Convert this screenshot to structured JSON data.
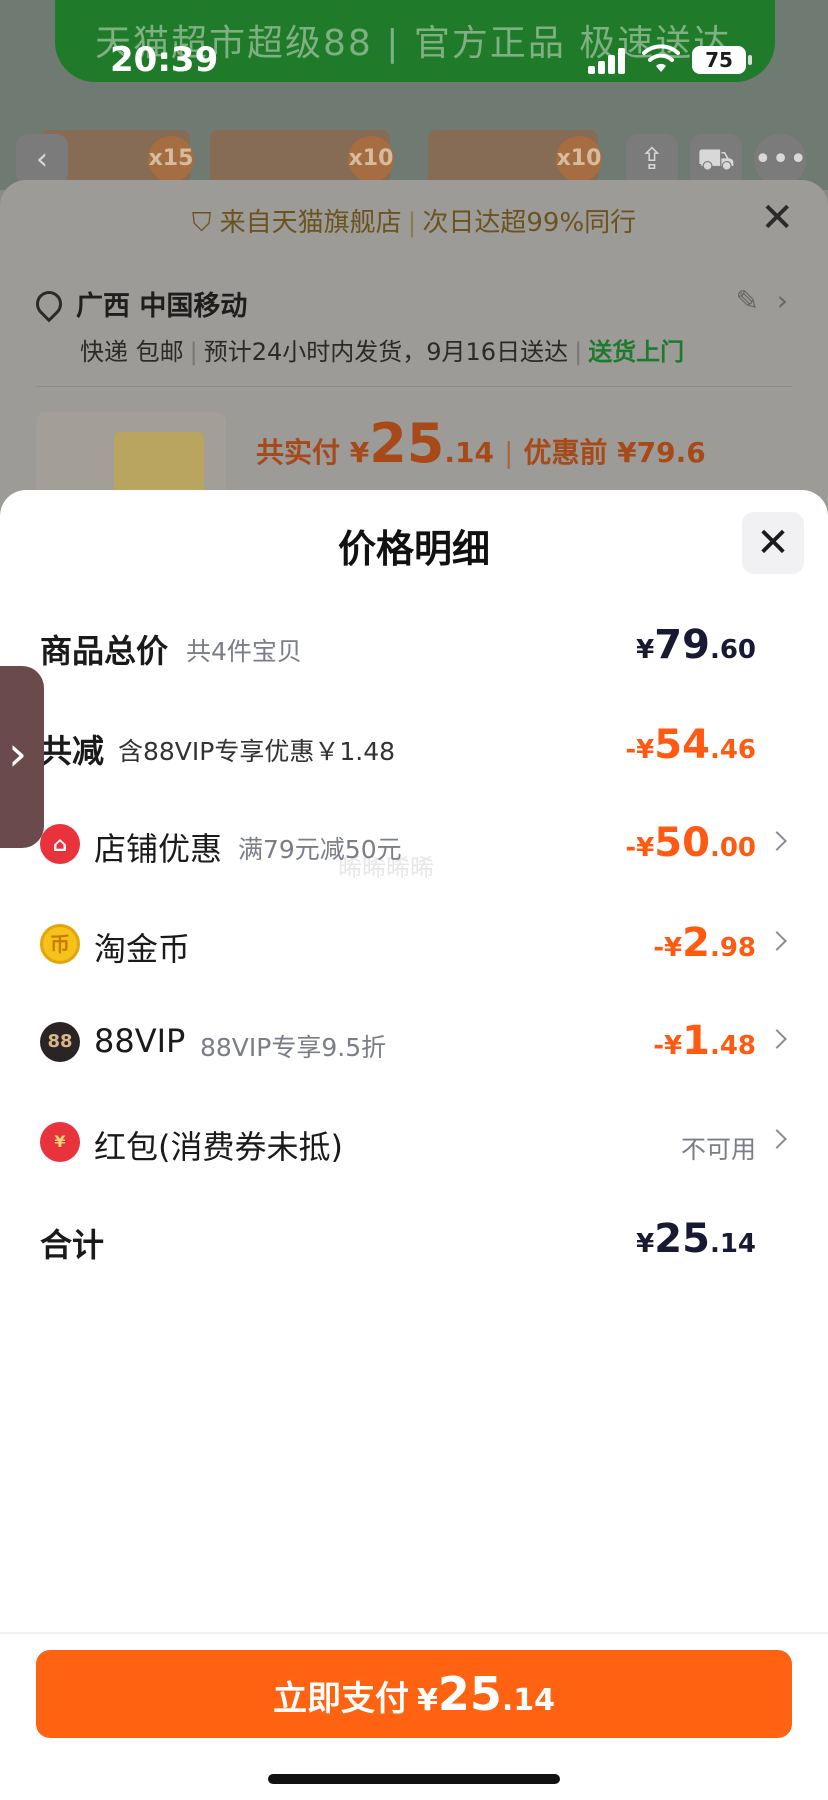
{
  "status_bar": {
    "time": "20:39",
    "battery": "75"
  },
  "background": {
    "banner_text": "天猫超市超级88 | 官方正品  极速送达",
    "thumb_badges": [
      "x15",
      "x10",
      "x10"
    ],
    "shop_tip": {
      "part1": "来自天猫旗舰店",
      "part2": "次日达超99%同行"
    },
    "address": "广西 中国移动",
    "delivery": {
      "method": "快递 包邮",
      "eta": "预计24小时内发货，9月16日送达",
      "door": "送货上门"
    },
    "pay_summary": {
      "label": "共实付 ¥",
      "int": "25",
      "dec": ".14",
      "before_label": "优惠前 ¥79.6"
    }
  },
  "sheet": {
    "title": "价格明细",
    "watermark": "晞晞晞晞",
    "rows": {
      "total": {
        "label": "商品总价",
        "sub": "共4件宝贝",
        "cur": "¥",
        "int": "79",
        "dec": ".60"
      },
      "reduce": {
        "label": "共减",
        "sub": "含88VIP专享优惠￥1.48",
        "cur": "-¥",
        "int": "54",
        "dec": ".46"
      },
      "shop": {
        "label": "店铺优惠",
        "sub": "满79元减50元",
        "cur": "-¥",
        "int": "50",
        "dec": ".00"
      },
      "coin": {
        "label": "淘金币",
        "cur": "-¥",
        "int": "2",
        "dec": ".98"
      },
      "vip": {
        "icon_text": "88",
        "label": "88VIP",
        "sub": "88VIP专享9.5折",
        "cur": "-¥",
        "int": "1",
        "dec": ".48"
      },
      "redpacket": {
        "label": "红包(消费券未抵)",
        "status": "不可用"
      },
      "sum": {
        "label": "合计",
        "cur": "¥",
        "int": "25",
        "dec": ".14"
      }
    },
    "pay_button": {
      "label": "立即支付",
      "cur": "¥",
      "int": "25",
      "dec": ".14"
    }
  },
  "colors": {
    "accent": "#ff6312",
    "discount": "#ff5a12",
    "price": "#181a33",
    "muted": "#7b7d88",
    "success_green": "#1e7a2f"
  }
}
